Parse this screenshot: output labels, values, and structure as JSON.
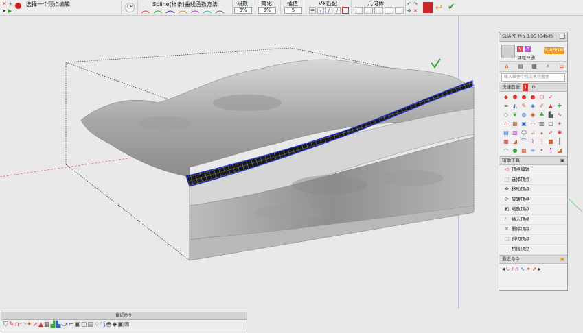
{
  "toolbar": {
    "status": "选择一个顶点编辑",
    "spline_method": "Spline(样条)曲线函数方法",
    "segments_label": "段数",
    "segments_value": "5%",
    "simplify_label": "简化",
    "simplify_value": "5%",
    "interp_label": "插值",
    "interp_value": "5",
    "vx_match": "VX匹配",
    "geometry": "几何体"
  },
  "suapp": {
    "title": "SUAPP Pro 3.85 (64bit)",
    "user_name": "课程神通",
    "version_badge": "SUAPP185",
    "search_placeholder": "输入插件中英文名称搜索",
    "quick_panel_label": "快捷面板",
    "quick_panel_count": "1",
    "aux_tools_label": "辅助工具",
    "recent_label": "最近命令",
    "tools": [
      {
        "label": "顶点编辑",
        "icon": "vertex-edit-icon"
      },
      {
        "label": "选择顶点",
        "icon": "select-vertex-icon"
      },
      {
        "label": "移动顶点",
        "icon": "move-vertex-icon"
      },
      {
        "label": "旋转顶点",
        "icon": "rotate-vertex-icon"
      },
      {
        "label": "缩放顶点",
        "icon": "scale-vertex-icon"
      },
      {
        "label": "插入顶点",
        "icon": "insert-vertex-icon"
      },
      {
        "label": "删除顶点",
        "icon": "delete-vertex-icon"
      },
      {
        "label": "斜切顶点",
        "icon": "shear-vertex-icon"
      },
      {
        "label": "桥接顶点",
        "icon": "bridge-vertex-icon"
      }
    ]
  },
  "recent_bar": {
    "label": "最近命令"
  }
}
